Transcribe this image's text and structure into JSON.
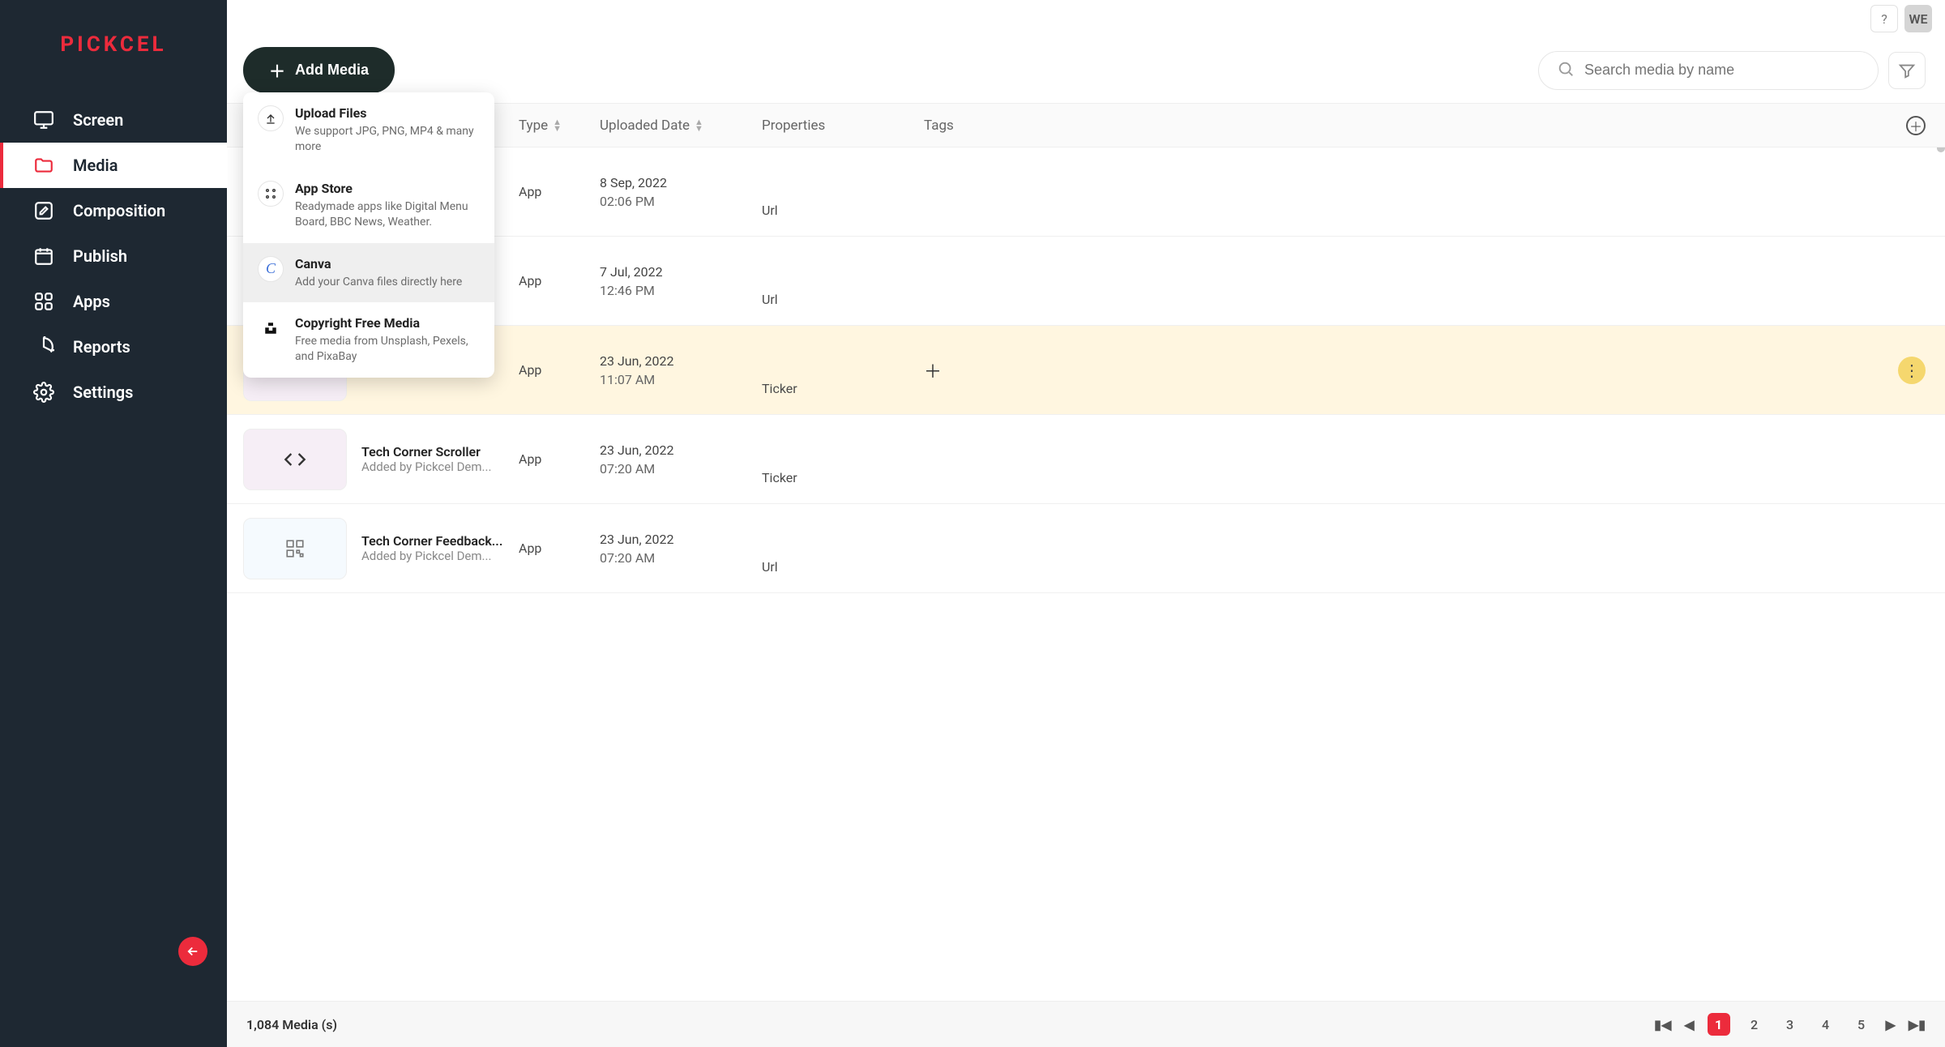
{
  "brand": "PICKCEL",
  "sidebar": {
    "items": [
      {
        "label": "Screen",
        "icon": "monitor-icon"
      },
      {
        "label": "Media",
        "icon": "folder-icon"
      },
      {
        "label": "Composition",
        "icon": "edit-square-icon"
      },
      {
        "label": "Publish",
        "icon": "calendar-icon"
      },
      {
        "label": "Apps",
        "icon": "grid-icon"
      },
      {
        "label": "Reports",
        "icon": "pie-icon"
      },
      {
        "label": "Settings",
        "icon": "gear-icon"
      }
    ],
    "active_index": 1
  },
  "topbar": {
    "help": "?",
    "avatar": "WE"
  },
  "toolbar": {
    "add_media_label": "Add Media",
    "search_placeholder": "Search media by name"
  },
  "dropdown": {
    "items": [
      {
        "title": "Upload Files",
        "desc": "We support JPG, PNG, MP4 & many more",
        "icon": "upload-icon"
      },
      {
        "title": "App Store",
        "desc": "Readymade apps like Digital Menu Board, BBC News, Weather.",
        "icon": "apps-grid-icon"
      },
      {
        "title": "Canva",
        "desc": "Add your Canva files directly here",
        "icon": "canva-icon"
      },
      {
        "title": "Copyright Free Media",
        "desc": "Free media from Unsplash, Pexels, and PixaBay",
        "icon": "unsplash-icon"
      }
    ],
    "hover_index": 2
  },
  "columns": {
    "name": "",
    "type": "Type",
    "date": "Uploaded Date",
    "properties": "Properties",
    "tags": "Tags"
  },
  "rows": [
    {
      "title": "",
      "sub": "",
      "type": "App",
      "date1": "8 Sep, 2022",
      "date2": "02:06 PM",
      "prop": "Url",
      "highlight": false,
      "thumb": "light",
      "glyph": ""
    },
    {
      "title": "",
      "sub": "",
      "type": "App",
      "date1": "7 Jul, 2022",
      "date2": "12:46 PM",
      "prop": "Url",
      "highlight": false,
      "thumb": "light",
      "glyph": ""
    },
    {
      "title": "",
      "sub": "",
      "type": "App",
      "date1": "23 Jun, 2022",
      "date2": "11:07 AM",
      "prop": "Ticker",
      "highlight": true,
      "thumb": "pink",
      "glyph": ""
    },
    {
      "title": "Tech Corner Scroller",
      "sub": "Added by Pickcel Dem...",
      "type": "App",
      "date1": "23 Jun, 2022",
      "date2": "07:20 AM",
      "prop": "Ticker",
      "highlight": false,
      "thumb": "pink",
      "glyph": "code"
    },
    {
      "title": "Tech Corner Feedback...",
      "sub": "Added by Pickcel Dem...",
      "type": "App",
      "date1": "23 Jun, 2022",
      "date2": "07:20 AM",
      "prop": "Url",
      "highlight": false,
      "thumb": "light",
      "glyph": "qr"
    }
  ],
  "footer": {
    "count_label": "1,084 Media (s)",
    "pages": [
      "1",
      "2",
      "3",
      "4",
      "5"
    ],
    "active_page_index": 0
  }
}
